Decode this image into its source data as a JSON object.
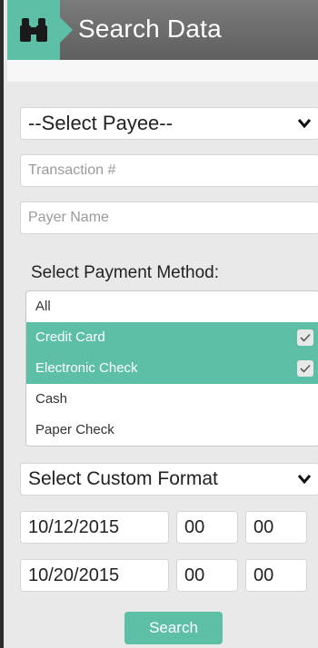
{
  "header": {
    "title": "Search Data",
    "icon": "binoculars-icon"
  },
  "payee_select": {
    "value": "--Select Payee--"
  },
  "transaction_input": {
    "placeholder": "Transaction #"
  },
  "payer_input": {
    "placeholder": "Payer Name"
  },
  "payment_method": {
    "label": "Select Payment Method:",
    "options": [
      {
        "label": "All",
        "selected": false
      },
      {
        "label": "Credit Card",
        "selected": true
      },
      {
        "label": "Electronic Check",
        "selected": true
      },
      {
        "label": "Cash",
        "selected": false
      },
      {
        "label": "Paper Check",
        "selected": false
      }
    ]
  },
  "format_select": {
    "value": "Select Custom Format"
  },
  "date_from": {
    "date": "10/12/2015",
    "hour": "00",
    "minute": "00"
  },
  "date_to": {
    "date": "10/20/2015",
    "hour": "00",
    "minute": "00"
  },
  "search_button": {
    "label": "Search"
  },
  "colors": {
    "accent": "#5dbfa6",
    "header": "#6b6b6b"
  }
}
